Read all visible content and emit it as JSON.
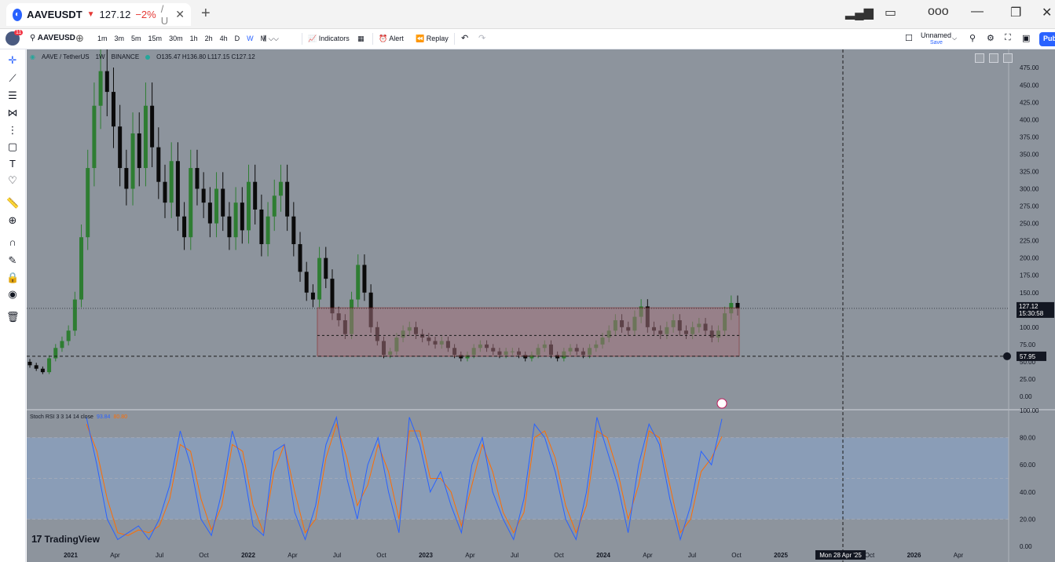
{
  "browser": {
    "tab_symbol": "AAVEUSDT",
    "tab_price": "127.12",
    "tab_change": "−2%",
    "tab_rest": "/ U",
    "new_tab": "+",
    "close": "✕"
  },
  "toolbar": {
    "notification_count": "11",
    "symbol": "AAVEUSD",
    "intervals": [
      "1m",
      "3m",
      "5m",
      "15m",
      "30m",
      "1h",
      "2h",
      "4h",
      "D",
      "W",
      "M"
    ],
    "active_interval": "W",
    "indicators_label": "Indicators",
    "alert_label": "Alert",
    "replay_label": "Replay",
    "layout_name": "Unnamed",
    "layout_save": "Save",
    "publish_label": "Pub"
  },
  "legend": {
    "title": "AAVE / TetherUS",
    "interval": "1W",
    "exchange": "BINANCE",
    "open": "O135.47",
    "high": "H136.80",
    "low": "L117.15",
    "close": "C127.12"
  },
  "stoch_legend": {
    "name": "Stoch RSI 3 3 14 14 close",
    "k_value": "93.84",
    "d_value": "80.80"
  },
  "watermark": "TradingView",
  "price_labels": {
    "last_price": "127.12",
    "countdown": "15:30:58",
    "crosshair_price": "57.95",
    "crosshair_time": "Mon 28 Apr '25"
  },
  "colors": {
    "background": "#8d949d",
    "up_candle": "#2e7d32",
    "down_candle": "#0b0b0b",
    "zone_fill": "#a0707a",
    "zone_border": "#8b1a1a",
    "stoch_k": "#2962ff",
    "stoch_d": "#ff6d00",
    "stoch_band": "#8aa0c0"
  },
  "chart_data": [
    {
      "type": "candlestick",
      "title": "AAVE / TetherUS",
      "interval": "1W",
      "y_axis_ticks": [
        "475.00",
        "450.00",
        "425.00",
        "400.00",
        "375.00",
        "350.00",
        "325.00",
        "300.00",
        "275.00",
        "250.00",
        "225.00",
        "200.00",
        "175.00",
        "150.00",
        "125.00",
        "100.00",
        "75.00",
        "50.00",
        "25.00",
        "0.00"
      ],
      "x_axis_ticks": [
        "2021",
        "Apr",
        "Jul",
        "Oct",
        "2022",
        "Apr",
        "Jul",
        "Oct",
        "2023",
        "Apr",
        "Jul",
        "Oct",
        "2024",
        "Apr",
        "Jul",
        "Oct",
        "2025",
        "Jul",
        "Oct",
        "2026",
        "Apr"
      ],
      "ylim": [
        0,
        490
      ],
      "close_series": [
        45,
        40,
        35,
        55,
        70,
        80,
        95,
        140,
        230,
        330,
        420,
        470,
        440,
        390,
        330,
        300,
        380,
        330,
        420,
        360,
        310,
        280,
        340,
        260,
        230,
        330,
        300,
        280,
        250,
        300,
        260,
        230,
        280,
        240,
        310,
        270,
        220,
        260,
        290,
        310,
        260,
        220,
        180,
        150,
        140,
        200,
        170,
        120,
        110,
        90,
        140,
        190,
        150,
        100,
        80,
        60,
        65,
        85,
        95,
        100,
        90,
        85,
        80,
        75,
        80,
        70,
        60,
        55,
        60,
        70,
        75,
        70,
        65,
        60,
        65,
        65,
        60,
        55,
        60,
        70,
        75,
        60,
        55,
        65,
        70,
        65,
        60,
        70,
        75,
        85,
        95,
        110,
        100,
        95,
        115,
        130,
        100,
        95,
        90,
        100,
        110,
        95,
        90,
        100,
        105,
        95,
        85,
        95,
        120,
        135,
        127
      ],
      "support_zone": {
        "top": 128,
        "bottom": 58,
        "mid": 88
      },
      "horizontal_lines": [
        127.12,
        57.95
      ],
      "last_price": 127.12
    },
    {
      "type": "line",
      "title": "Stoch RSI 3 3 14 14 close",
      "y_axis_ticks": [
        "100.00",
        "80.00",
        "60.00",
        "40.00",
        "20.00",
        "0.00"
      ],
      "ylim": [
        0,
        100
      ],
      "bands": [
        20,
        80
      ],
      "series": [
        {
          "name": "K",
          "values": [
            95,
            60,
            20,
            5,
            10,
            15,
            5,
            20,
            45,
            85,
            60,
            20,
            8,
            40,
            85,
            60,
            15,
            8,
            70,
            75,
            25,
            5,
            30,
            75,
            95,
            50,
            20,
            60,
            80,
            40,
            10,
            95,
            75,
            40,
            55,
            30,
            10,
            60,
            80,
            40,
            20,
            5,
            35,
            90,
            80,
            55,
            20,
            5,
            40,
            95,
            70,
            45,
            10,
            60,
            90,
            75,
            35,
            5,
            30,
            70,
            60,
            93.84
          ]
        },
        {
          "name": "D",
          "values": [
            90,
            70,
            35,
            10,
            8,
            12,
            10,
            15,
            35,
            75,
            70,
            35,
            12,
            30,
            75,
            70,
            30,
            10,
            55,
            75,
            40,
            10,
            20,
            65,
            90,
            65,
            30,
            45,
            75,
            55,
            20,
            85,
            85,
            50,
            50,
            40,
            15,
            45,
            75,
            55,
            25,
            10,
            25,
            80,
            85,
            65,
            30,
            10,
            30,
            85,
            80,
            55,
            20,
            45,
            85,
            80,
            45,
            10,
            20,
            55,
            65,
            80.8
          ]
        }
      ],
      "k_value": 93.84,
      "d_value": 80.8
    }
  ]
}
